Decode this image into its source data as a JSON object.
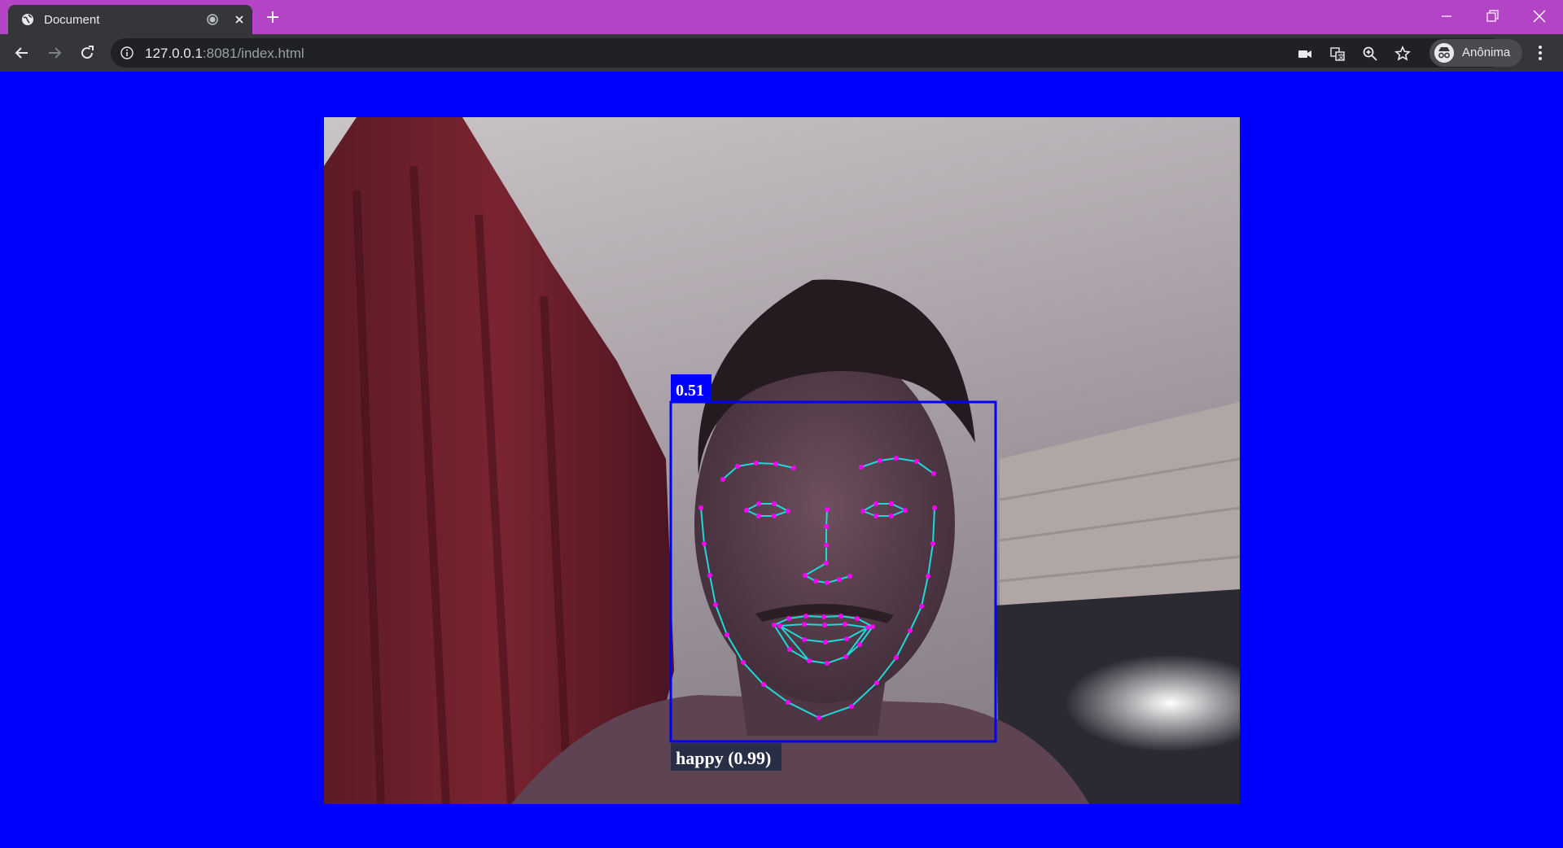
{
  "browser": {
    "tab_title": "Document",
    "url_host": "127.0.0.1",
    "url_rest": ":8081/index.html",
    "profile_name": "Anônima"
  },
  "colors": {
    "page_background": "#0000ff",
    "titlebar": "#b344c6",
    "box": "#0000ff",
    "landmark_point": "#ff00ff",
    "landmark_line": "#20d8d8"
  },
  "detection": {
    "score_label": "0.51",
    "expression_label": "happy (0.99)",
    "score": 0.51,
    "expression": "happy",
    "expression_confidence": 0.99
  },
  "icons": {
    "tab": "globe-icon",
    "recording": "recording-icon",
    "close": "close-icon",
    "new_tab": "plus-icon",
    "back": "arrow-left-icon",
    "forward": "arrow-right-icon",
    "reload": "reload-icon",
    "site_info": "info-icon",
    "camera": "camera-icon",
    "translate": "translate-icon",
    "zoom": "zoom-icon",
    "bookmark": "star-icon",
    "incognito": "incognito-icon",
    "menu": "kebab-menu-icon"
  }
}
